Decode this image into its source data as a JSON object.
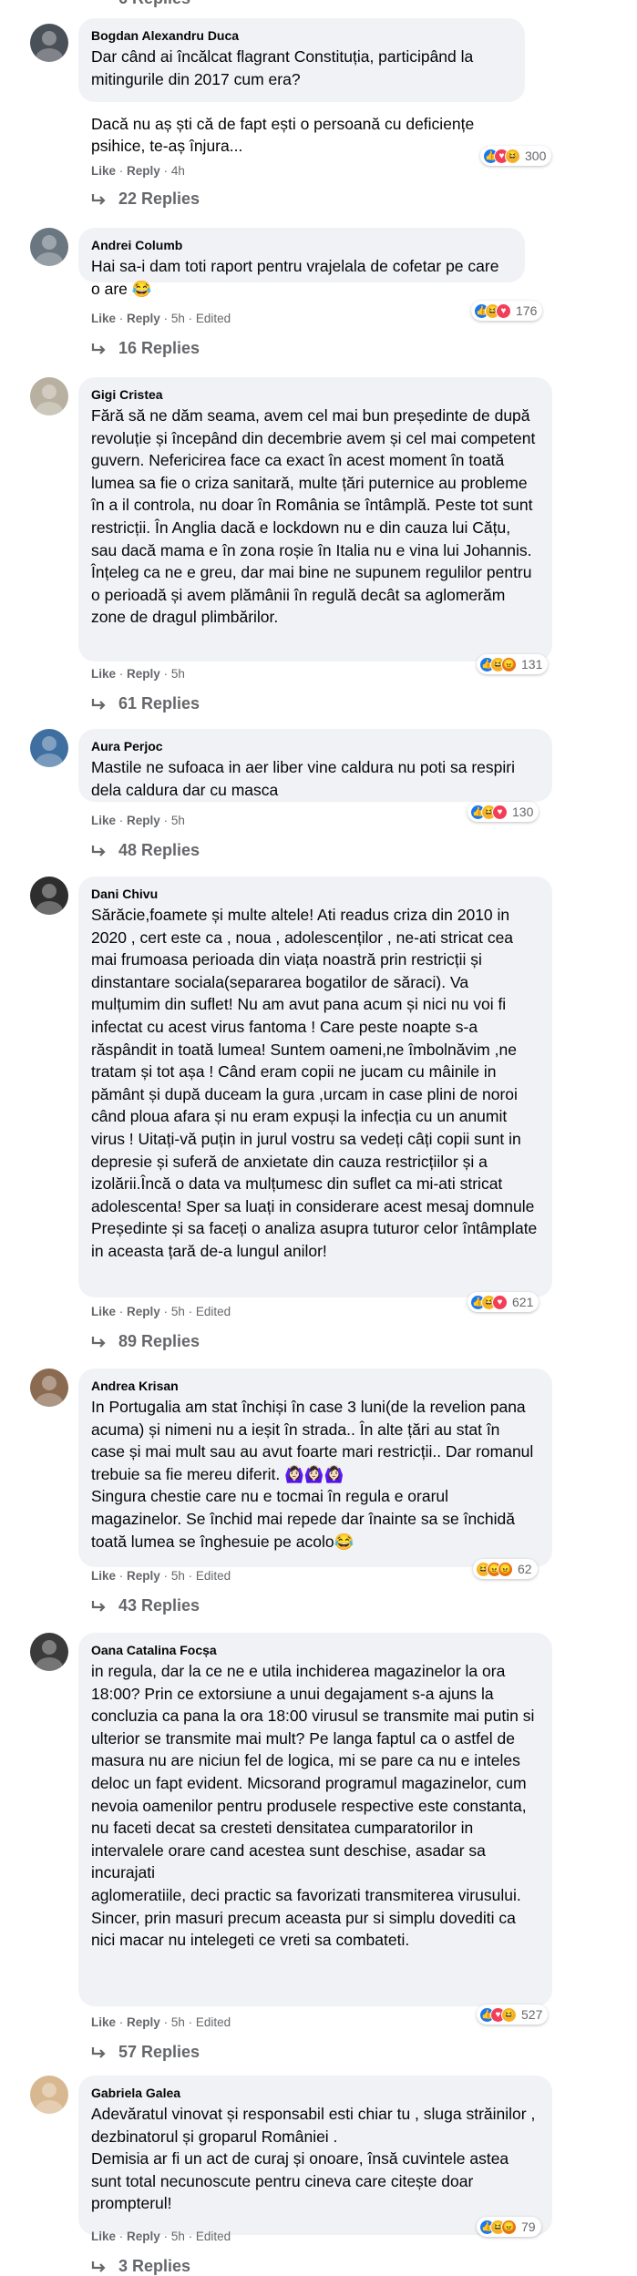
{
  "top_stub": "6 Replies",
  "actions": {
    "like": "Like",
    "reply": "Reply",
    "sep": "·",
    "edited": "Edited"
  },
  "comments": [
    {
      "author": "Bogdan Alexandru Duca",
      "text": "Dar când ai încălcat flagrant Constituția, participând la mitingurile din 2017 cum era?\n\nDacă nu aș ști că de fapt ești o persoană cu deficiențe psihice, te-aș înjura...",
      "time": "4h",
      "edited": false,
      "reactions": [
        "like",
        "love",
        "haha"
      ],
      "reaction_count": "300",
      "replies": "22 Replies",
      "avatar_color": "#4a5058"
    },
    {
      "author": "Andrei Columb",
      "text": "Hai sa-i dam toti raport pentru vrajelala de cofetar pe care o are 😂",
      "time": "5h",
      "edited": true,
      "reactions": [
        "like",
        "haha",
        "love"
      ],
      "reaction_count": "176",
      "replies": "16 Replies",
      "avatar_color": "#6a7680"
    },
    {
      "author": "Gigi Cristea",
      "text": "Fără să ne dăm seama, avem cel mai bun președinte de după revoluție și începând din decembrie avem și cel mai competent guvern. Nefericirea face ca exact în acest moment în toată lumea sa fie o criza sanitară, multe țări puternice au probleme în a il controla, nu doar în România se întâmplă. Peste tot sunt restricții. În Anglia dacă e lockdown nu e din cauza lui Cățu, sau dacă mama e în zona roșie în Italia nu e vina lui Johannis. Înțeleg ca ne e greu, dar mai bine ne supunem regulilor pentru o perioadă și avem plămânii în regulă decât sa aglomerăm zone de dragul plimbărilor.",
      "time": "5h",
      "edited": false,
      "reactions": [
        "like",
        "haha",
        "angry"
      ],
      "reaction_count": "131",
      "replies": "61 Replies",
      "avatar_color": "#b8b0a0"
    },
    {
      "author": "Aura Perjoc",
      "text": "Mastile ne sufoaca in aer liber vine caldura nu poti sa respiri dela caldura dar cu masca",
      "time": "5h",
      "edited": false,
      "reactions": [
        "like",
        "haha",
        "love"
      ],
      "reaction_count": "130",
      "replies": "48 Replies",
      "avatar_color": "#3f6fa0"
    },
    {
      "author": "Dani Chivu",
      "text": "Sărăcie,foamete și multe altele! Ati readus criza din 2010 in 2020 , cert este ca , noua , adolescenților , ne-ati stricat cea mai frumoasa perioada din viața noastră prin restricții și dinstantare sociala(separarea bogatilor de săraci). Va mulțumim din suflet! Nu am avut pana acum și nici nu voi fi infectat cu acest virus fantoma ! Care peste noapte s-a răspândit in toată lumea! Suntem oameni,ne îmbolnăvim ,ne tratam și tot așa ! Când eram copii ne jucam cu mâinile in pământ și după duceam la gura ,urcam in case plini de noroi când ploua afara și nu eram expuși la infecția cu un anumit virus ! Uitați-vă puțin in jurul vostru sa vedeți câți copii sunt in depresie și suferă de anxietate din cauza restricțiilor și a izolării.Încă o data va mulțumesc din suflet ca mi-ati stricat adolescenta! Sper sa luați in considerare acest mesaj domnule Președinte și sa faceți o analiza asupra tuturor celor întâmplate in aceasta țară de-a lungul anilor!",
      "time": "5h",
      "edited": true,
      "reactions": [
        "like",
        "haha",
        "love"
      ],
      "reaction_count": "621",
      "replies": "89 Replies",
      "avatar_color": "#2e2e2e"
    },
    {
      "author": "Andrea Krisan",
      "text": "In Portugalia am stat închiși în case 3 luni(de la revelion pana acuma) și nimeni nu a ieșit în strada.. În alte țări au stat în case și mai mult sau au avut foarte mari restricții.. Dar romanul trebuie sa fie mereu diferit. 🙆🏻‍♀️🙆🏻‍♀️🙆🏻‍♀️\nSingura chestie care nu e tocmai în regula e orarul magazinelor. Se închid mai repede dar înainte sa se închidă toată lumea se înghesuie pe acolo😂",
      "time": "5h",
      "edited": true,
      "reactions": [
        "haha",
        "angry",
        "angry"
      ],
      "reaction_count": "62",
      "replies": "43 Replies",
      "avatar_color": "#8a6a50"
    },
    {
      "author": "Oana Catalina Focșa",
      "text": "in regula, dar la ce ne e utila inchiderea magazinelor la ora 18:00? Prin ce extorsiune a unui degajament s-a ajuns la concluzia ca pana la ora 18:00 virusul se transmite mai putin si ulterior se transmite mai mult? Pe langa faptul ca o astfel de masura nu are niciun fel de logica, mi se pare ca nu e inteles deloc un fapt evident. Micsorand programul magazinelor, cum nevoia oamenilor pentru produsele respective este constanta, nu faceti decat sa cresteti densitatea cumparatorilor in intervalele orare cand acestea sunt deschise, asadar sa incurajati\naglomeratiile, deci practic sa favorizati transmiterea virusului. Sincer, prin masuri precum aceasta pur si simplu dovediti ca nici macar nu intelegeti ce vreti sa combateti.",
      "time": "5h",
      "edited": true,
      "reactions": [
        "like",
        "love",
        "haha"
      ],
      "reaction_count": "527",
      "replies": "57 Replies",
      "avatar_color": "#3a3a3a"
    },
    {
      "author": "Gabriela Galea",
      "text": "Adevăratul vinovat și responsabil esti chiar tu , sluga străinilor , dezbinatorul și groparul României .\nDemisia ar fi un act de curaj și onoare, însă cuvintele astea sunt total necunoscute pentru cineva care citește doar prompterul!",
      "time": "5h",
      "edited": true,
      "reactions": [
        "like",
        "haha",
        "angry"
      ],
      "reaction_count": "79",
      "replies": "3 Replies",
      "avatar_color": "#d8b890"
    }
  ]
}
